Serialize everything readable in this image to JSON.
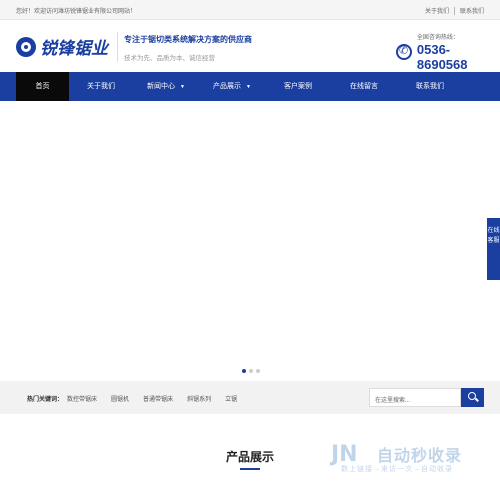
{
  "topbar": {
    "welcome": "您好！欢迎访问潍坊锐锋锯业有限公司网站！",
    "links": [
      "关于我们",
      "联系我们"
    ]
  },
  "header": {
    "logo_text": "锐锋锯业",
    "slogan_main": "专注于锯切类系统解决方案的供应商",
    "slogan_sub": "技术为先、品质为本、诚信经营",
    "hotline_label": "全国咨询热线：",
    "hotline_number": "0536-8690568"
  },
  "nav": {
    "items": [
      {
        "label": "首页",
        "active": true
      },
      {
        "label": "关于我们"
      },
      {
        "label": "新闻中心",
        "caret": "▼"
      },
      {
        "label": "产品展示",
        "caret": "▼"
      },
      {
        "label": "客户案例"
      },
      {
        "label": "在线留言"
      },
      {
        "label": "联系我们"
      }
    ]
  },
  "side_tab": {
    "label": "在线客服"
  },
  "hotwords": {
    "label": "热门关键词：",
    "items": [
      "数控带锯床",
      "圆锯机",
      "普通带锯床",
      "斜锯系列",
      "立锯"
    ]
  },
  "search": {
    "placeholder": "在这里搜索..."
  },
  "section": {
    "title": "产品展示"
  },
  "watermark": {
    "logo": "JN",
    "main": "自动秒收录",
    "sub": "数上链接→来访一次→自动收录"
  },
  "colors": {
    "primary": "#1a3fa0",
    "nav_active": "#0a0a0a"
  }
}
